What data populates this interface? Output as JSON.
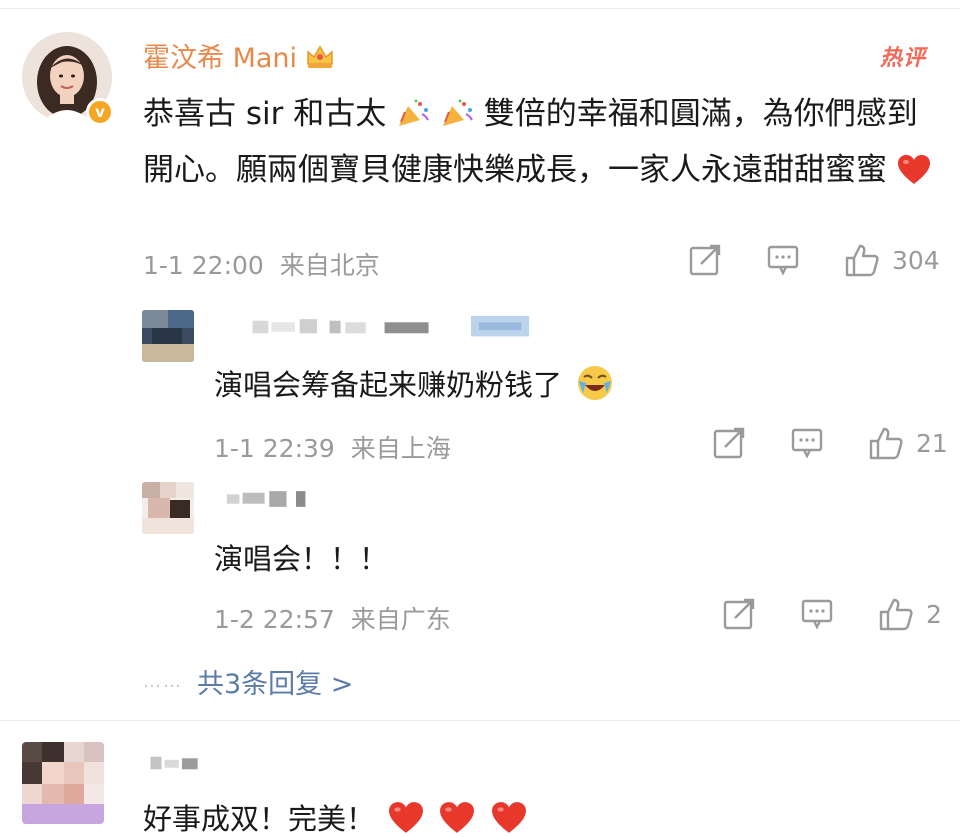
{
  "main_comment": {
    "author": "霍汶希 Mani",
    "badge": "v",
    "hot_label": "热评",
    "text_part1": "恭喜古 sir 和古太",
    "text_part2": "雙倍的幸福和圓滿，為你們感到開心。願兩個寶貝健康快樂成長，一家人永遠甜甜蜜蜜",
    "timestamp": "1-1 22:00",
    "location": "来自北京",
    "likes": "304"
  },
  "replies": [
    {
      "text": "演唱会筹备起来赚奶粉钱了",
      "timestamp": "1-1 22:39",
      "location": "来自上海",
      "likes": "21"
    },
    {
      "text": "演唱会！！！",
      "timestamp": "1-2 22:57",
      "location": "来自广东",
      "likes": "2"
    }
  ],
  "more_replies": {
    "dots": "……",
    "label": "共3条回复 >"
  },
  "bottom_comment": {
    "text": "好事成双！完美！"
  },
  "colors": {
    "author": "#e8894a",
    "hot": "#f26a5a",
    "link": "#5b7ba8",
    "meta": "#9a9a9a",
    "heart": "#e8382c"
  }
}
